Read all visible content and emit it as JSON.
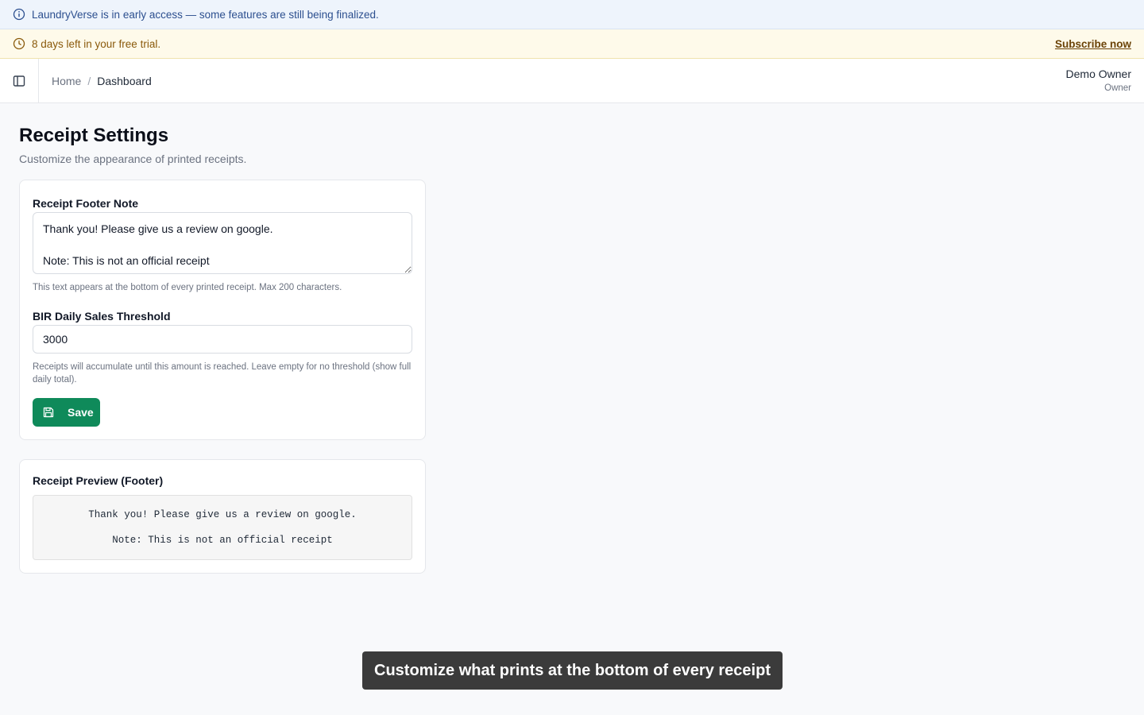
{
  "banners": {
    "info": {
      "text": "LaundryVerse is in early access — some features are still being finalized.",
      "icon": "info-icon",
      "color": "#2c4f8f",
      "background": "#eef4fc"
    },
    "trial": {
      "text": "8 days left in your free trial.",
      "icon": "clock-icon",
      "action_label": "Subscribe now",
      "color": "#8a5a0b",
      "background": "#fefaea"
    }
  },
  "topbar": {
    "sidebar_toggle_icon": "sidebar-panel-icon",
    "breadcrumb": {
      "home": "Home",
      "separator": "/",
      "current": "Dashboard"
    },
    "user": {
      "name": "Demo Owner",
      "role": "Owner"
    }
  },
  "page": {
    "title": "Receipt Settings",
    "subtitle": "Customize the appearance of printed receipts."
  },
  "settings_card": {
    "footer_note": {
      "label": "Receipt Footer Note",
      "value": "Thank you! Please give us a review on google.\n\nNote: This is not an official receipt",
      "help": "This text appears at the bottom of every printed receipt. Max 200 characters."
    },
    "threshold": {
      "label": "BIR Daily Sales Threshold",
      "value": "3000",
      "help": "Receipts will accumulate until this amount is reached. Leave empty for no threshold (show full daily total)."
    },
    "save_button": {
      "label": "Save",
      "icon": "save-icon",
      "color": "#0f8a5a"
    }
  },
  "preview_card": {
    "label": "Receipt Preview (Footer)",
    "lines": [
      "Thank you! Please give us a review on google.",
      "Note: This is not an official receipt"
    ]
  },
  "tooltip": {
    "text": "Customize what prints at the bottom of every receipt"
  }
}
